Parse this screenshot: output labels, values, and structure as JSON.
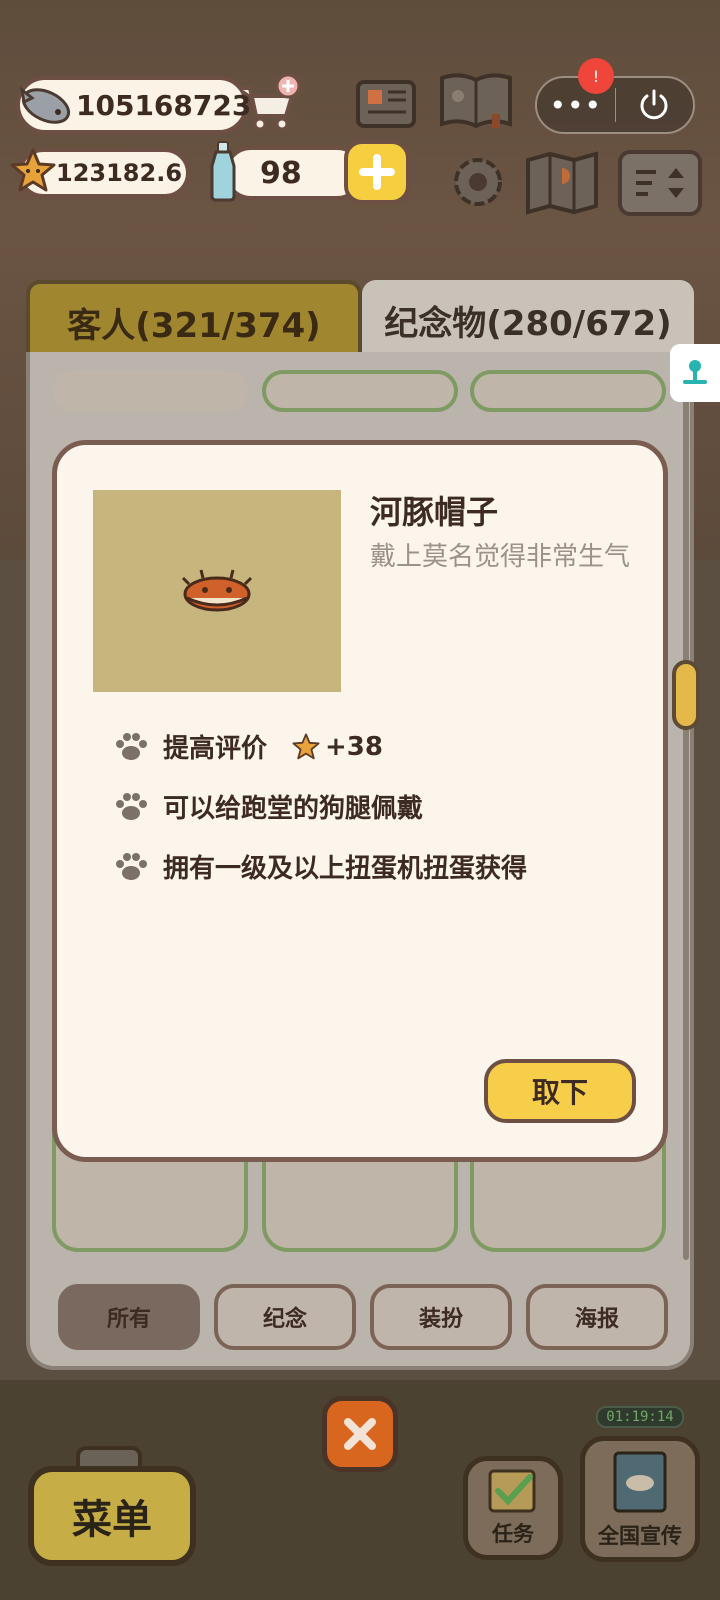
{
  "currencies": {
    "fish": "105168723",
    "stars": "123182.6",
    "bottles": "98"
  },
  "capsule": {
    "more_label": "•••",
    "badge": "!"
  },
  "tabs": {
    "guests": "客人(321/374)",
    "souvenirs": "纪念物(280/672)"
  },
  "item": {
    "name": "河豚帽子",
    "description": "戴上莫名觉得非常生气",
    "properties": [
      {
        "text": "提高评价",
        "bonus": "+38"
      },
      {
        "text": "可以给跑堂的狗腿佩戴"
      },
      {
        "text": "拥有一级及以上扭蛋机扭蛋获得"
      }
    ],
    "action_label": "取下"
  },
  "filters": [
    "所有",
    "纪念",
    "装扮",
    "海报"
  ],
  "active_filter": "所有",
  "bottom": {
    "menu": "菜单",
    "task": "任务",
    "promo": "全国宣传",
    "timer": "01:19:14"
  },
  "colors": {
    "accent_yellow": "#f7ce49",
    "panel_border": "#7a5c50",
    "modal_bg": "#fbf5ec",
    "green_border": "#7f9a62"
  }
}
